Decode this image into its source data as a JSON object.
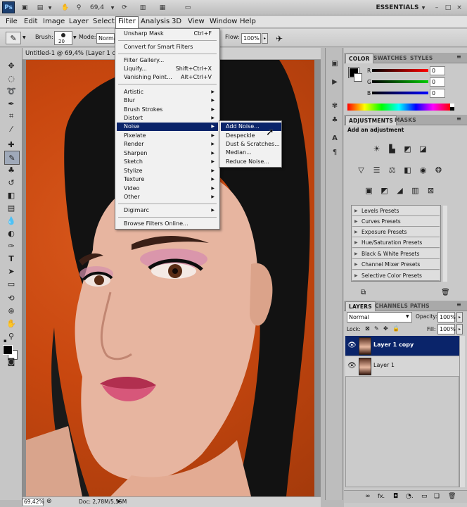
{
  "app": {
    "logo": "Ps",
    "zoom": "69,4",
    "workspace": "ESSENTIALS",
    "window_controls": [
      "–",
      "□",
      "×"
    ]
  },
  "menubar": [
    "File",
    "Edit",
    "Image",
    "Layer",
    "Select",
    "Filter",
    "Analysis",
    "3D",
    "View",
    "Window",
    "Help"
  ],
  "options_bar": {
    "brush_label": "Brush:",
    "brush_size": "20",
    "mode_label": "Mode:",
    "mode_value": "Normal",
    "flow_label": "Flow:",
    "flow_value": "100%"
  },
  "document": {
    "tab_title": "Untitled-1 @ 69,4% (Layer 1 co",
    "status_zoom": "69,42%",
    "status_doc": "Doc: 2,78M/5,55M"
  },
  "filter_menu": {
    "items": [
      {
        "label": "Unsharp Mask",
        "shortcut": "Ctrl+F"
      },
      {
        "label": "Convert for Smart Filters"
      },
      {
        "label": "Filter Gallery..."
      },
      {
        "label": "Liquify...",
        "shortcut": "Shift+Ctrl+X"
      },
      {
        "label": "Vanishing Point...",
        "shortcut": "Alt+Ctrl+V"
      },
      {
        "label": "Artistic",
        "arrow": "▶"
      },
      {
        "label": "Blur",
        "arrow": "▶"
      },
      {
        "label": "Brush Strokes",
        "arrow": "▶"
      },
      {
        "label": "Distort",
        "arrow": "▶"
      },
      {
        "label": "Noise",
        "arrow": "▶"
      },
      {
        "label": "Pixelate",
        "arrow": "▶"
      },
      {
        "label": "Render",
        "arrow": "▶"
      },
      {
        "label": "Sharpen",
        "arrow": "▶"
      },
      {
        "label": "Sketch",
        "arrow": "▶"
      },
      {
        "label": "Stylize",
        "arrow": "▶"
      },
      {
        "label": "Texture",
        "arrow": "▶"
      },
      {
        "label": "Video",
        "arrow": "▶"
      },
      {
        "label": "Other",
        "arrow": "▶"
      },
      {
        "label": "Digimarc",
        "arrow": "▶"
      },
      {
        "label": "Browse Filters Online..."
      }
    ]
  },
  "noise_submenu": [
    "Add Noise...",
    "Despeckle",
    "Dust & Scratches...",
    "Median...",
    "Reduce Noise..."
  ],
  "color_panel": {
    "tabs": [
      "COLOR",
      "SWATCHES",
      "STYLES"
    ],
    "channels": [
      {
        "label": "R",
        "value": "0"
      },
      {
        "label": "G",
        "value": "0"
      },
      {
        "label": "B",
        "value": "0"
      }
    ]
  },
  "adjustments_panel": {
    "tabs": [
      "ADJUSTMENTS",
      "MASKS"
    ],
    "heading": "Add an adjustment",
    "presets": [
      "Levels Presets",
      "Curves Presets",
      "Exposure Presets",
      "Hue/Saturation Presets",
      "Black & White Presets",
      "Channel Mixer Presets",
      "Selective Color Presets"
    ]
  },
  "layers_panel": {
    "tabs": [
      "LAYERS",
      "CHANNELS",
      "PATHS"
    ],
    "blend_mode": "Normal",
    "opacity_label": "Opacity:",
    "opacity_value": "100%",
    "lock_label": "Lock:",
    "fill_label": "Fill:",
    "fill_value": "100%",
    "layers": [
      {
        "name": "Layer 1 copy",
        "selected": true
      },
      {
        "name": "Layer 1",
        "selected": false
      }
    ],
    "footer_icons": [
      "∞",
      "fx.",
      "◘",
      "◔.",
      "▭",
      "❏",
      "🗑"
    ]
  },
  "colors": {
    "menu_highlight": "#0a246a",
    "backdrop": "#c8470f"
  }
}
